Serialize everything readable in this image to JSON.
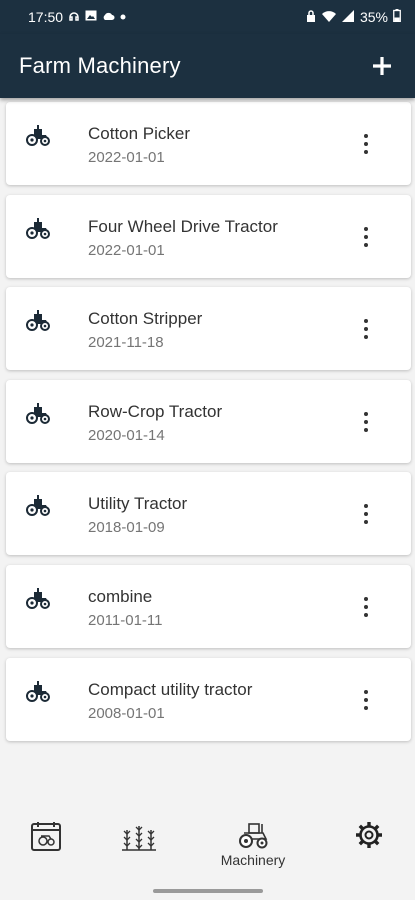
{
  "status_bar": {
    "time": "17:50",
    "battery": "35%",
    "left_icons": [
      "headset-icon",
      "image-icon",
      "cloud-icon",
      "dot-icon"
    ],
    "right_icons": [
      "lock-icon",
      "wifi-icon",
      "signal-icon"
    ]
  },
  "app_bar": {
    "title": "Farm Machinery",
    "add_icon": "plus-icon"
  },
  "machinery": [
    {
      "name": "Cotton Picker",
      "date": "2022-01-01"
    },
    {
      "name": "Four Wheel Drive Tractor",
      "date": "2022-01-01"
    },
    {
      "name": "Cotton Stripper",
      "date": "2021-11-18"
    },
    {
      "name": "Row-Crop Tractor",
      "date": "2020-01-14"
    },
    {
      "name": "Utility Tractor",
      "date": "2018-01-09"
    },
    {
      "name": "combine",
      "date": "2011-01-11"
    },
    {
      "name": "Compact utility tractor",
      "date": "2008-01-01"
    }
  ],
  "bottom_nav": {
    "items": [
      {
        "icon": "calendar-icon",
        "label": ""
      },
      {
        "icon": "crops-icon",
        "label": ""
      },
      {
        "icon": "tractor-icon",
        "label": "Machinery",
        "active": true
      },
      {
        "icon": "gear-icon",
        "label": ""
      }
    ]
  },
  "colors": {
    "app_bar": "#1c3040",
    "background": "#f3f3f3",
    "card": "#ffffff",
    "title_text": "#333333",
    "date_text": "#757575"
  }
}
